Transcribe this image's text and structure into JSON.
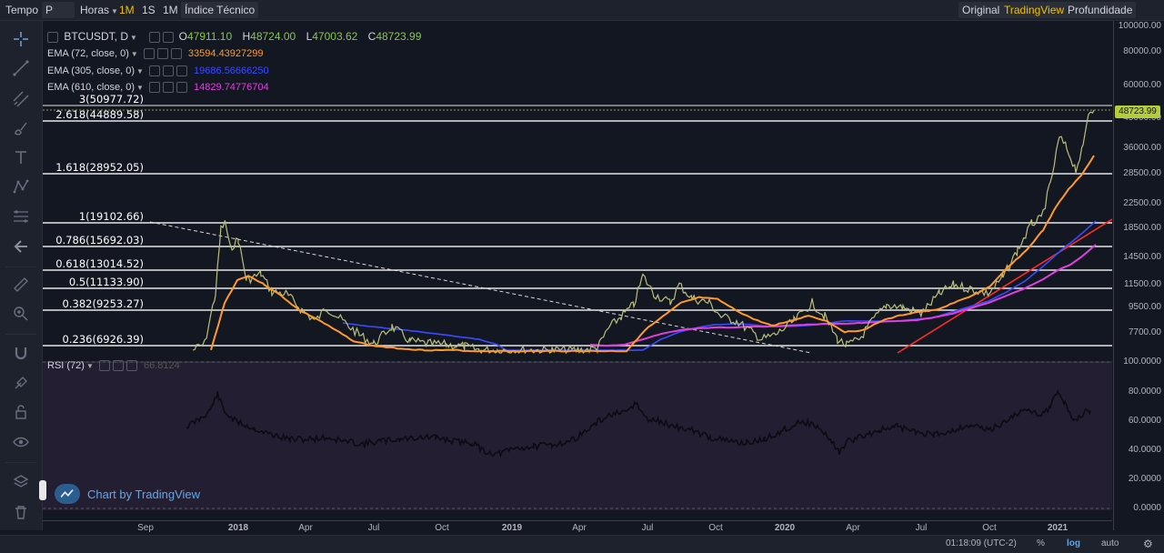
{
  "topbar": {
    "tempo_label": "Tempo",
    "period_value": "P",
    "horas_label": "Horas",
    "intervals": [
      "1M",
      "1S",
      "1M"
    ],
    "indicators_label": "Índice Técnico",
    "view_original": "Original",
    "view_tradingview": "TradingView",
    "view_depth": "Profundidade"
  },
  "legend": {
    "symbol": "BTCUSDT, D",
    "open_label": "O",
    "open": "47911.10",
    "high_label": "H",
    "high": "48724.00",
    "low_label": "L",
    "low": "47003.62",
    "close_label": "C",
    "close": "48723.99",
    "ema": [
      {
        "label": "EMA (72, close, 0)",
        "value": "33594.43927299",
        "color": "#ff9a2a"
      },
      {
        "label": "EMA (305, close, 0)",
        "value": "19686.56666250",
        "color": "#3a4bff"
      },
      {
        "label": "EMA (610, close, 0)",
        "value": "14829.74776704",
        "color": "#e040e0"
      }
    ]
  },
  "fib_levels": [
    {
      "label": "3(50977.72)",
      "price": 50977.72
    },
    {
      "label": "2.618(44889.58)",
      "price": 44889.58
    },
    {
      "label": "1.618(28952.05)",
      "price": 28952.05
    },
    {
      "label": "1(19102.66)",
      "price": 19102.66
    },
    {
      "label": "0.786(15692.03)",
      "price": 15692.03
    },
    {
      "label": "0.618(13014.52)",
      "price": 13014.52
    },
    {
      "label": "0.5(11133.90)",
      "price": 11133.9
    },
    {
      "label": "0.382(9253.27)",
      "price": 9253.27
    },
    {
      "label": "0.236(6926.39)",
      "price": 6926.39
    }
  ],
  "price_axis_labels": [
    "100000.00",
    "80000.00",
    "60000.00",
    "45000.00",
    "36000.00",
    "28500.00",
    "22500.00",
    "18500.00",
    "14500.00",
    "11500.00",
    "9500.00",
    "7700.00"
  ],
  "last_price_tag": "48723.99",
  "rsi": {
    "label": "RSI (72)",
    "value": "66.8124",
    "axis_labels": [
      "100.0000",
      "80.0000",
      "60.0000",
      "40.0000",
      "20.0000",
      "0.0000"
    ]
  },
  "time_axis_labels": [
    "Sep",
    "2018",
    "Apr",
    "Jul",
    "Oct",
    "2019",
    "Apr",
    "Jul",
    "Oct",
    "2020",
    "Apr",
    "Jul",
    "Oct",
    "2021"
  ],
  "branding": "Chart by TradingView",
  "bottombar": {
    "clock": "01:18:09 (UTC-2)",
    "pct": "%",
    "log": "log",
    "auto": "auto"
  },
  "colors": {
    "price": "#b9c07c",
    "ema72": "#ff9a2a",
    "ema305": "#3a4bff",
    "ema610": "#e040e0",
    "trend_red": "#ff2a2a",
    "rsi_bg": "#241e33",
    "last_tag": "#b5cc3c",
    "accent": "#f0c000"
  },
  "icons": [
    "crosshair-icon",
    "trend-line-icon",
    "channel-icon",
    "brush-icon",
    "text-icon",
    "pattern-icon",
    "fib-icon",
    "back-arrow-icon",
    "ruler-icon",
    "zoom-icon",
    "magnet-icon",
    "lock-drawing-icon",
    "lock-icon",
    "eye-icon",
    "layers-icon",
    "trash-icon"
  ]
}
